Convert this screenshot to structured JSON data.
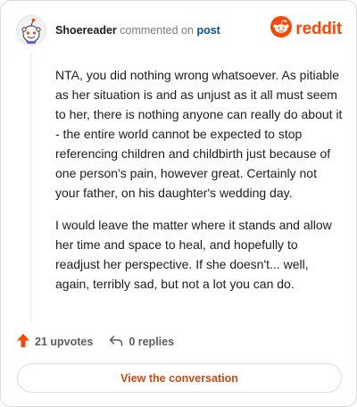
{
  "header": {
    "username": "Shoereader",
    "action_text": "commented on",
    "link_text": "post",
    "brand_name": "reddit"
  },
  "comment": {
    "paragraphs": [
      "NTA, you did nothing wrong whatsoever. As pitiable as her situation is and as unjust as it all must seem to her, there is nothing anyone can really do about it - the entire world cannot be expected to stop referencing children and childbirth just because of one person's pain, however great. Certainly not your father, on his daughter's wedding day.",
      "I would leave the matter where it stands and allow her time and space to heal, and hopefully to readjust her perspective. If she doesn't... well, again, terribly sad, but not a lot you can do."
    ]
  },
  "actions": {
    "upvotes_label": "21 upvotes",
    "replies_label": "0 replies"
  },
  "cta": {
    "label": "View the conversation"
  },
  "colors": {
    "brand": "#ff4500",
    "link": "#0a4ea2",
    "cta_text": "#c94a15"
  },
  "icons": {
    "avatar": "snoo-avatar-icon",
    "logo": "reddit-logo-icon",
    "upvote": "upvote-arrow-icon",
    "reply": "reply-arrow-icon"
  }
}
